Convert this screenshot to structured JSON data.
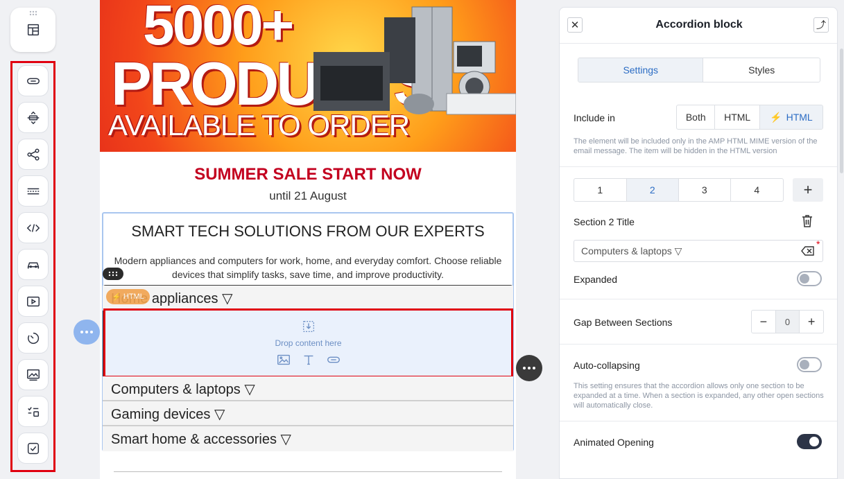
{
  "toolbar": {
    "items": [
      "button-icon",
      "spacer-icon",
      "social-icon",
      "divider-icon",
      "html-code-icon",
      "menu-icon",
      "video-icon",
      "timer-icon",
      "banner-icon",
      "form-icon",
      "checkbox-icon"
    ]
  },
  "email": {
    "banner": {
      "line1": "5000+",
      "line2": "PRODUCTS",
      "line3": "AVAILABLE TO ORDER"
    },
    "sale_title": "SUMMER SALE START NOW",
    "sale_subtitle": "until 21 August",
    "block_title": "SMART TECH SOLUTIONS FROM OUR EXPERTS",
    "block_desc": "Modern appliances and computers for work, home, and everyday comfort. Choose reliable devices that simplify tasks, save time, and improve productivity.",
    "html_badge": "HTML",
    "sections": [
      {
        "title": "Home appliances ▽"
      },
      {
        "title": "Computers & laptops ▽"
      },
      {
        "title": "Gaming devices ▽"
      },
      {
        "title": "Smart home & accessories ▽"
      }
    ],
    "drop_text": "Drop content here"
  },
  "panel": {
    "title": "Accordion block",
    "tabs": {
      "settings": "Settings",
      "styles": "Styles"
    },
    "include_in": {
      "label": "Include in",
      "options": [
        "Both",
        "HTML",
        "HTML"
      ],
      "hint": "The element will be included only in the AMP HTML MIME version of the email message. The item will be hidden in the HTML version"
    },
    "section_tabs": [
      "1",
      "2",
      "3",
      "4"
    ],
    "add": "+",
    "section_title_label": "Section 2 Title",
    "section_title_value": "Computers & laptops ▽",
    "expanded_label": "Expanded",
    "gap_label": "Gap Between Sections",
    "gap_value": "0",
    "minus": "−",
    "auto_collapsing_label": "Auto-collapsing",
    "auto_collapsing_hint": "This setting ensures that the accordion allows only one section to be expanded at a time. When a section is expanded, any other open sections will automatically close.",
    "animated_label": "Animated Opening"
  },
  "colors": {
    "accent": "#2b6cc4",
    "highlight": "#e0000f",
    "sale_red": "#c3001f"
  }
}
